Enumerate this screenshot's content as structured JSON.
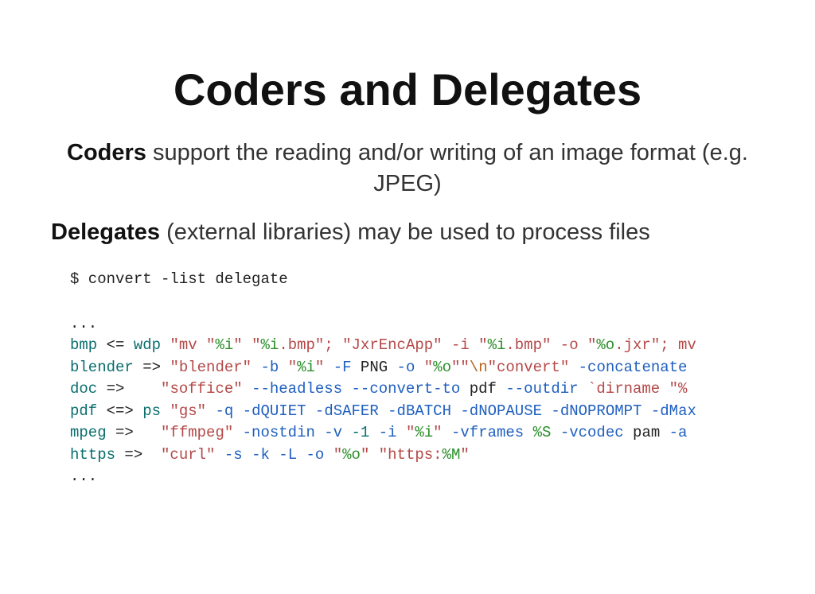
{
  "title": "Coders and Delegates",
  "para1": {
    "strong": "Coders",
    "rest": " support the reading and/or writing of an image format (e.g. JPEG)"
  },
  "para2": {
    "strong": "Delegates",
    "rest": " (external libraries) may be used to process files"
  },
  "code": {
    "cmd": "$ convert -list delegate",
    "blank": "",
    "ell1": "...",
    "line_bmp": {
      "key": "bmp",
      "op": " <= ",
      "wdp": "wdp",
      "sp1": " ",
      "q1": "\"mv \"",
      "v1": "%i",
      "q2": "\" \"",
      "v2": "%i",
      "q3": ".bmp\"; \"JxrEncApp\" -i \"",
      "v3": "%i",
      "q4": ".bmp\" -o \"",
      "v4": "%o",
      "q5": ".jxr\"; mv"
    },
    "line_blender": {
      "key": "blender",
      "op": " => ",
      "q1": "\"blender\"",
      "sp1": " ",
      "b": "-b",
      "sp2": " ",
      "q2": "\"",
      "v1": "%i",
      "q3": "\"",
      "sp3": " ",
      "F": "-F",
      "sp4": " PNG ",
      "o": "-o",
      "sp5": " ",
      "q4": "\"",
      "v2": "%o",
      "q5": "\"\"",
      "nl": "\\n",
      "q6": "\"convert\"",
      "sp6": " ",
      "conc": "-concatenate"
    },
    "line_doc": {
      "key": "doc",
      "op": " =>    ",
      "q1": "\"soffice\"",
      "sp1": " ",
      "h1": "--headless",
      "sp2": " ",
      "h2": "--convert-to",
      "sp3": " pdf ",
      "h3": "--outdir",
      "sp4": " ",
      "bt": "`dirname \"%"
    },
    "line_pdf": {
      "key": "pdf",
      "op": " <=> ",
      "ps": "ps",
      "sp1": " ",
      "q1": "\"gs\"",
      "sp2": " ",
      "q": "-q",
      "sp3": " ",
      "d1": "-dQUIET",
      "sp4": " ",
      "d2": "-dSAFER",
      "sp5": " ",
      "d3": "-dBATCH",
      "sp6": " ",
      "d4": "-dNOPAUSE",
      "sp7": " ",
      "d5": "-dNOPROMPT",
      "sp8": " ",
      "d6": "-dMax"
    },
    "line_mpeg": {
      "key": "mpeg",
      "op": " =>   ",
      "q1": "\"ffmpeg\"",
      "sp1": " ",
      "n1": "-nostdin",
      "sp2": " ",
      "v": "-v",
      "sp3": " ",
      "neg1": "-1",
      "sp4": " ",
      "i": "-i",
      "sp5": " ",
      "q2": "\"",
      "vi": "%i",
      "q3": "\"",
      "sp6": " ",
      "vf": "-vframes",
      "sp7": " ",
      "S": "%S",
      "sp8": " ",
      "vc": "-vcodec",
      "sp9": " pam ",
      "a": "-a"
    },
    "line_https": {
      "key": "https",
      "op": " =>  ",
      "q1": "\"curl\"",
      "sp1": " ",
      "s": "-s",
      "sp2": " ",
      "k": "-k",
      "sp3": " ",
      "L": "-L",
      "sp4": " ",
      "o": "-o",
      "sp5": " ",
      "q2": "\"",
      "vo": "%o",
      "q3": "\" \"https:",
      "M": "%M",
      "q4": "\""
    },
    "ell2": "..."
  }
}
